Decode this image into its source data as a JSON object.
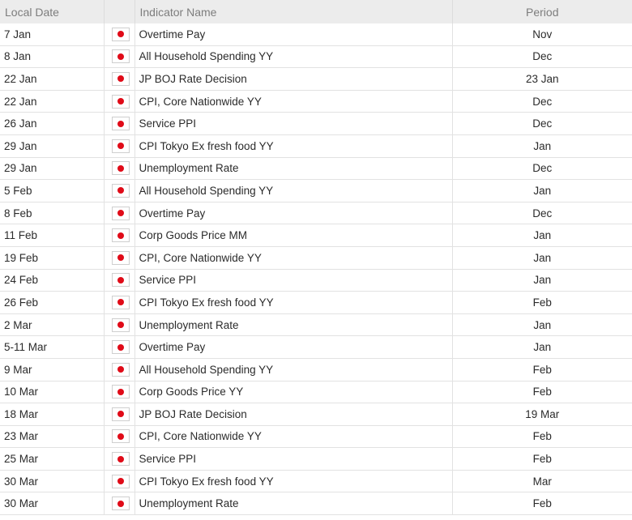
{
  "headers": {
    "date": "Local Date",
    "flag": "",
    "name": "Indicator Name",
    "period": "Period"
  },
  "flag_icon": "japan-flag-icon",
  "rows": [
    {
      "date": "7 Jan",
      "name": "Overtime Pay",
      "period": "Nov"
    },
    {
      "date": "8 Jan",
      "name": "All Household Spending YY",
      "period": "Dec"
    },
    {
      "date": "22 Jan",
      "name": "JP BOJ Rate Decision",
      "period": "23 Jan"
    },
    {
      "date": "22 Jan",
      "name": "CPI, Core Nationwide YY",
      "period": "Dec"
    },
    {
      "date": "26 Jan",
      "name": "Service PPI",
      "period": "Dec"
    },
    {
      "date": "29 Jan",
      "name": "CPI Tokyo Ex fresh food YY",
      "period": "Jan"
    },
    {
      "date": "29 Jan",
      "name": "Unemployment Rate",
      "period": "Dec"
    },
    {
      "date": "5 Feb",
      "name": "All Household Spending YY",
      "period": "Jan"
    },
    {
      "date": "8 Feb",
      "name": "Overtime Pay",
      "period": "Dec"
    },
    {
      "date": "11 Feb",
      "name": "Corp Goods Price MM",
      "period": "Jan"
    },
    {
      "date": "19 Feb",
      "name": "CPI, Core Nationwide YY",
      "period": "Jan"
    },
    {
      "date": "24 Feb",
      "name": "Service PPI",
      "period": "Jan"
    },
    {
      "date": "26 Feb",
      "name": "CPI Tokyo Ex fresh food YY",
      "period": "Feb"
    },
    {
      "date": "2 Mar",
      "name": "Unemployment Rate",
      "period": "Jan"
    },
    {
      "date": "5-11 Mar",
      "name": "Overtime Pay",
      "period": "Jan"
    },
    {
      "date": "9 Mar",
      "name": "All Household Spending YY",
      "period": "Feb"
    },
    {
      "date": "10 Mar",
      "name": "Corp Goods Price YY",
      "period": "Feb"
    },
    {
      "date": "18 Mar",
      "name": "JP BOJ Rate Decision",
      "period": "19 Mar"
    },
    {
      "date": "23 Mar",
      "name": "CPI, Core Nationwide YY",
      "period": "Feb"
    },
    {
      "date": "25 Mar",
      "name": "Service PPI",
      "period": "Feb"
    },
    {
      "date": "30 Mar",
      "name": "CPI Tokyo Ex fresh food YY",
      "period": "Mar"
    },
    {
      "date": "30 Mar",
      "name": "Unemployment Rate",
      "period": "Feb"
    }
  ]
}
